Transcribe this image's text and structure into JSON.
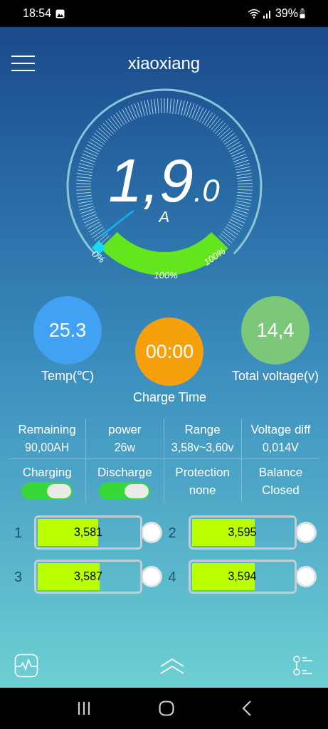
{
  "status_bar": {
    "time": "18:54",
    "battery": "39%"
  },
  "header": {
    "title": "xiaoxiang"
  },
  "gauge": {
    "value": "1,9",
    "decimal": ".0",
    "unit": "A",
    "arc_labels": [
      "0%",
      "100%",
      "100%"
    ]
  },
  "dials": [
    {
      "value": "25.3",
      "label": "Temp(℃)",
      "color": "#41a2f3"
    },
    {
      "value": "00:00",
      "label": "Charge Time",
      "color": "#f6a10c"
    },
    {
      "value": "14,4",
      "label": "Total voltage(v)",
      "color": "#7bc87b"
    }
  ],
  "stats": [
    {
      "label": "Remaining",
      "value": "90,00AH"
    },
    {
      "label": "power",
      "value": "26w"
    },
    {
      "label": "Range",
      "value": "3,58v~3,60v"
    },
    {
      "label": "Voltage diff",
      "value": "0,014V"
    }
  ],
  "controls": [
    {
      "kind": "switch",
      "label": "Charging",
      "on": true
    },
    {
      "kind": "switch",
      "label": "Discharge",
      "on": true
    },
    {
      "kind": "text",
      "label": "Protection",
      "value": "none"
    },
    {
      "kind": "text",
      "label": "Balance",
      "value": "Closed"
    }
  ],
  "cells": [
    {
      "index": "1",
      "value": "3,581",
      "level": 0.6
    },
    {
      "index": "2",
      "value": "3,595",
      "level": 0.62
    },
    {
      "index": "3",
      "value": "3,587",
      "level": 0.61
    },
    {
      "index": "4",
      "value": "3,594",
      "level": 0.62
    }
  ]
}
